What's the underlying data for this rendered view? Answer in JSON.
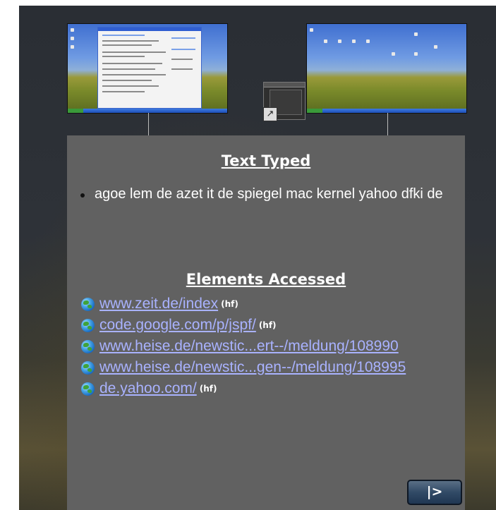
{
  "text_typed": {
    "heading": "Text Typed",
    "items": [
      "agoe lem de azet it de spiegel mac kernel yahoo dfki de"
    ]
  },
  "elements_accessed": {
    "heading": "Elements Accessed",
    "links": [
      {
        "url": "www.zeit.de/index",
        "tag": "(hf)"
      },
      {
        "url": "code.google.com/p/jspf/",
        "tag": "(hf)"
      },
      {
        "url": "www.heise.de/newstic...ert--/meldung/108990",
        "tag": ""
      },
      {
        "url": "www.heise.de/newstic...gen--/meldung/108995",
        "tag": ""
      },
      {
        "url": "de.yahoo.com/",
        "tag": "(hf)"
      }
    ]
  },
  "controls": {
    "play_label": "|>"
  },
  "icons": {
    "link_icon": "globe-icon",
    "shortcut_icon": "shortcut-arrow-icon"
  },
  "colors": {
    "panel_bg": "#616161",
    "link": "#a9b2ff"
  }
}
